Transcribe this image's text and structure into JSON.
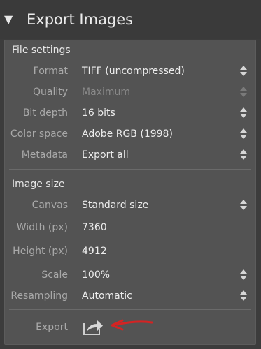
{
  "header": {
    "title": "Export Images",
    "collapse_icon": "triangle-down-icon"
  },
  "file_settings": {
    "title": "File settings",
    "rows": [
      {
        "label": "Format",
        "value": "TIFF (uncompressed)",
        "enabled": true
      },
      {
        "label": "Quality",
        "value": "Maximum",
        "enabled": false
      },
      {
        "label": "Bit depth",
        "value": "16 bits",
        "enabled": true
      },
      {
        "label": "Color space",
        "value": "Adobe RGB (1998)",
        "enabled": true
      },
      {
        "label": "Metadata",
        "value": "Export all",
        "enabled": true
      }
    ]
  },
  "image_size": {
    "title": "Image size",
    "rows": [
      {
        "label": "Canvas",
        "value": "Standard size",
        "has_stepper": true
      },
      {
        "label": "Width (px)",
        "value": "7360",
        "has_stepper": false
      },
      {
        "label": "Height (px)",
        "value": "4912",
        "has_stepper": false
      },
      {
        "label": "Scale",
        "value": "100%",
        "has_stepper": true
      },
      {
        "label": "Resampling",
        "value": "Automatic",
        "has_stepper": true
      }
    ]
  },
  "export": {
    "label": "Export",
    "icon": "export-share-icon",
    "annotation_color": "#d42323"
  },
  "colors": {
    "panel_bg": "#535353",
    "page_bg": "#3c3c3c"
  }
}
